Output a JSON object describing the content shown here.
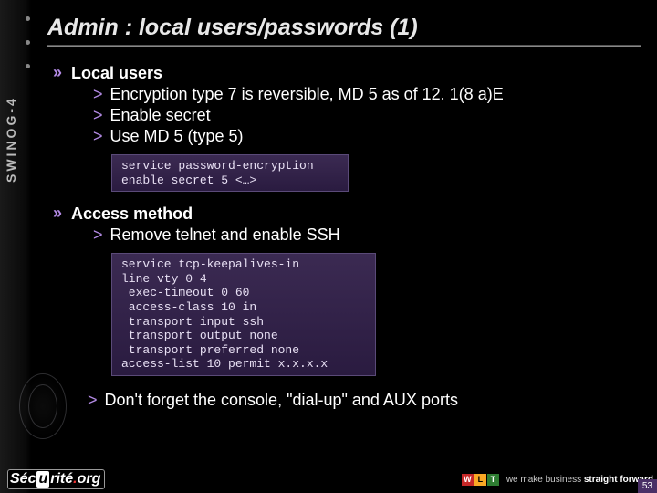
{
  "sidebar": {
    "label": "SWINOG-4"
  },
  "title": "Admin : local users/passwords (1)",
  "sections": [
    {
      "heading": "Local users",
      "bullets": [
        "Encryption type 7 is reversible, MD 5 as of 12. 1(8 a)E",
        "Enable secret",
        "Use MD 5 (type 5)"
      ],
      "code": [
        "service password-encryption",
        "enable secret 5 <…>"
      ]
    },
    {
      "heading": "Access method",
      "bullets": [
        "Remove telnet and enable SSH"
      ],
      "code": [
        "service tcp-keepalives-in",
        "line vty 0 4",
        " exec-timeout 0 60",
        " access-class 10 in",
        " transport input ssh",
        " transport output none",
        " transport preferred none",
        "access-list 10 permit x.x.x.x"
      ],
      "bullets_after": [
        "Don't forget the console, \"dial-up\" and AUX ports"
      ]
    }
  ],
  "footer": {
    "brand": "Sécurité.org",
    "tiles": [
      "W",
      "L",
      "T"
    ],
    "tagline_pre": "we make business ",
    "tagline_bold": "straight forward",
    "page": "53"
  }
}
